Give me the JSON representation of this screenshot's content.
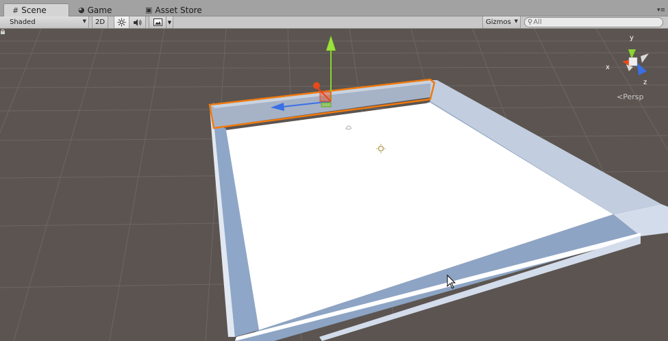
{
  "tabs": [
    {
      "label": "Scene",
      "icon": "scene-grid-icon",
      "active": true
    },
    {
      "label": "Game",
      "icon": "game-pacman-icon",
      "active": false
    },
    {
      "label": "Asset Store",
      "icon": "asset-store-bag-icon",
      "active": false
    }
  ],
  "toolbar": {
    "draw_mode": "Shaded",
    "mode_2d": "2D",
    "gizmos": "Gizmos",
    "search_placeholder": "All"
  },
  "orientation_gizmo": {
    "axis_x": "x",
    "axis_y": "y",
    "axis_z": "z",
    "projection": "Persp"
  },
  "colors": {
    "viewport_bg": "#5b5450",
    "grid_line": "#6c6662",
    "selection_outline": "#f07a0f",
    "axis_x": "#e8491a",
    "axis_y": "#8bd42f",
    "axis_z": "#3a6fe6",
    "floor": "#ffffff",
    "wall": "#c9d5e6"
  }
}
